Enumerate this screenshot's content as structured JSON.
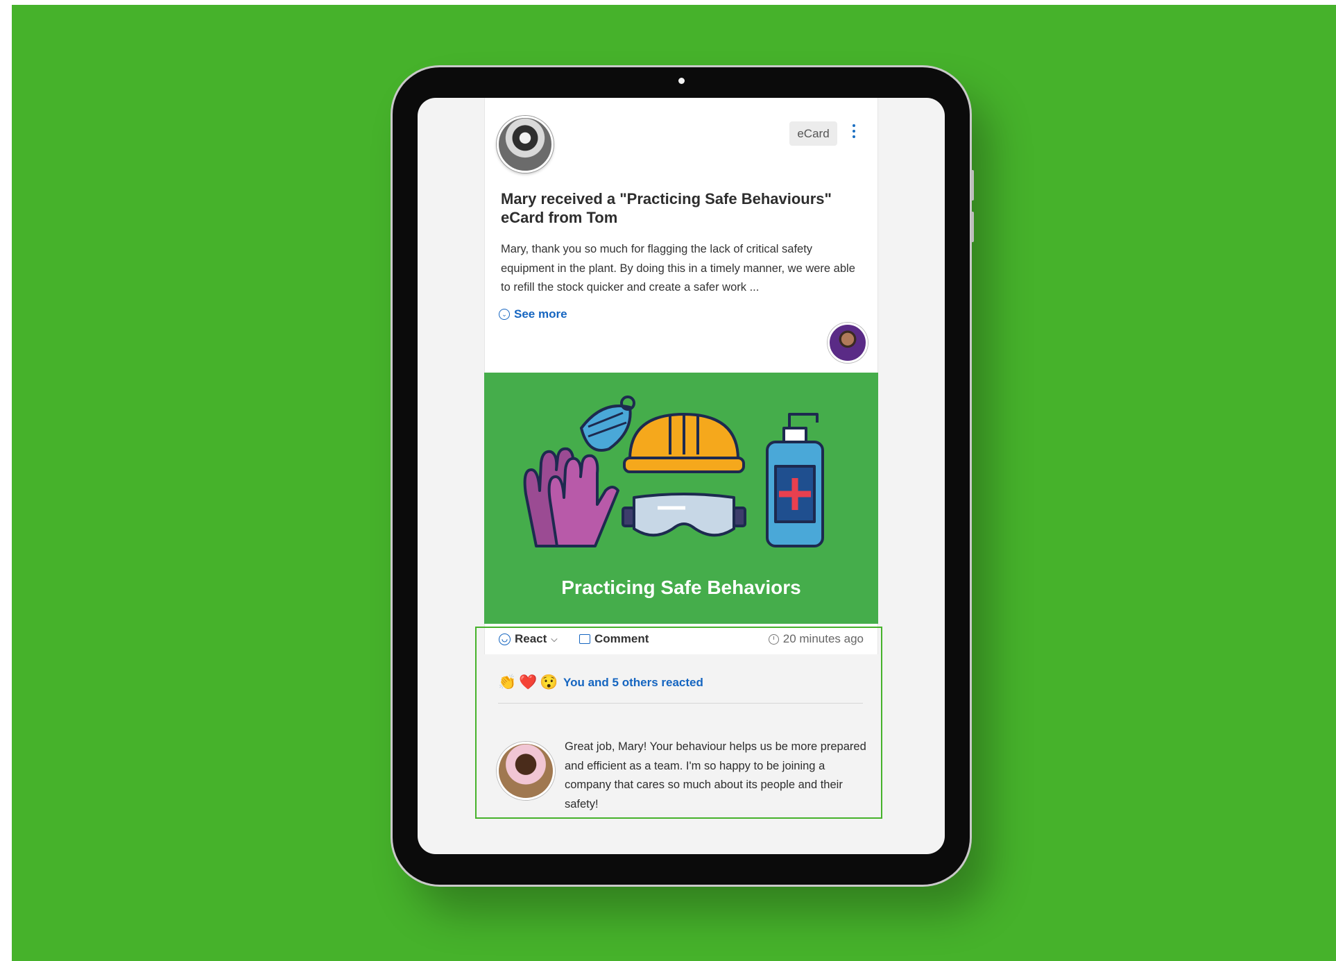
{
  "colors": {
    "background": "#46b22b",
    "accent": "#1565c0",
    "card_image_bg": "#45ad4b",
    "highlight_border": "#46b22b"
  },
  "post": {
    "badge": "eCard",
    "title": "Mary received a \"Practicing Safe Behaviours\" eCard from Tom",
    "body": "Mary, thank you so much for flagging the lack of critical safety equipment in the plant. By doing this in a timely manner, we were able to refill the stock quicker and create a safer work ...",
    "see_more": "See more",
    "image_caption": "Practicing Safe Behaviors",
    "icons": [
      "user-avatar",
      "kebab-menu-icon",
      "chevron-circle-icon",
      "sender-avatar"
    ]
  },
  "actions": {
    "react_label": "React",
    "comment_label": "Comment",
    "timestamp": "20 minutes ago",
    "icons": [
      "smile-icon",
      "chevron-down-icon",
      "comment-bubble-icon",
      "clock-icon"
    ]
  },
  "reactions": {
    "emojis": [
      "👏",
      "❤️",
      "😯"
    ],
    "summary": "You and 5 others reacted"
  },
  "comment": {
    "text": "Great job, Mary! Your behaviour helps us be more prepared and efficient as a team. I'm so happy to be joining a company that cares so much about its people and their safety!"
  }
}
